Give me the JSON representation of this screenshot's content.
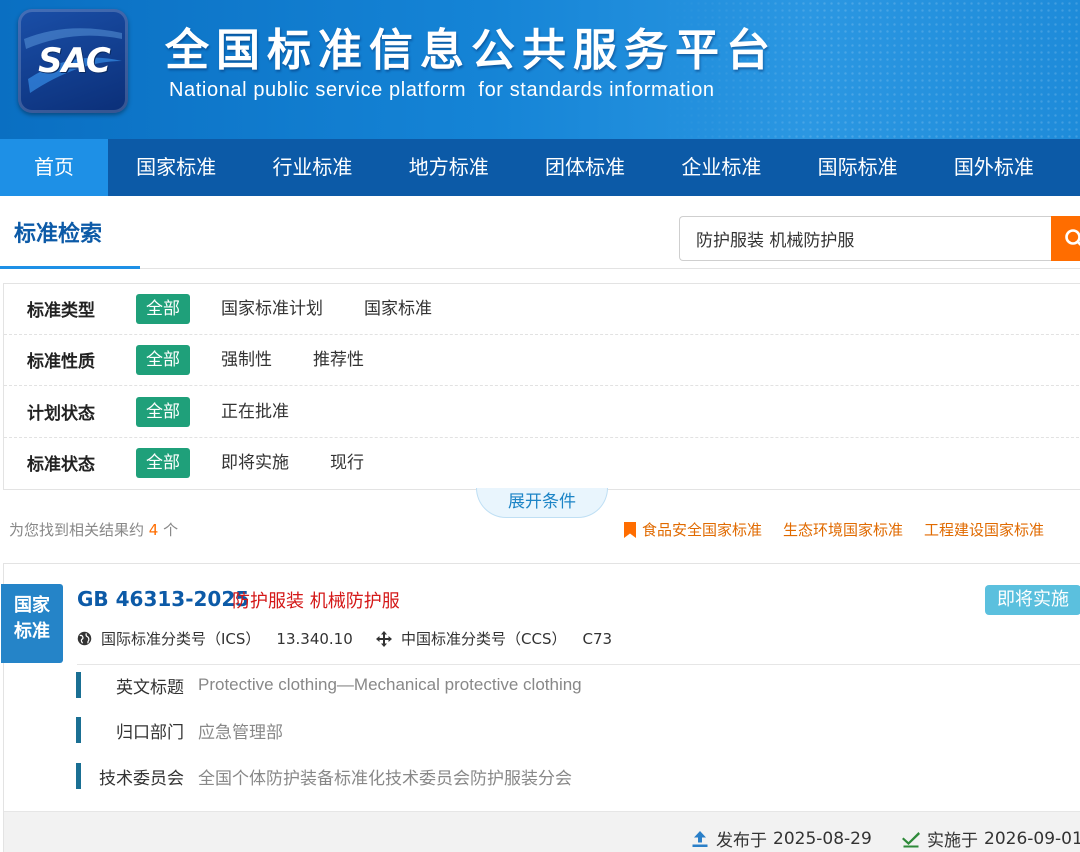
{
  "header": {
    "logo_text": "SAC",
    "title": "全国标准信息公共服务平台",
    "subtitle": "National public service platform  for standards information"
  },
  "nav": {
    "items": [
      {
        "label": "首页",
        "active": true
      },
      {
        "label": "国家标准"
      },
      {
        "label": "行业标准"
      },
      {
        "label": "地方标准"
      },
      {
        "label": "团体标准"
      },
      {
        "label": "企业标准"
      },
      {
        "label": "国际标准"
      },
      {
        "label": "国外标准"
      }
    ]
  },
  "search": {
    "section_title": "标准检索",
    "query": "防护服装 机械防护服"
  },
  "filters": [
    {
      "label": "标准类型",
      "options": [
        "全部",
        "国家标准计划",
        "国家标准"
      ]
    },
    {
      "label": "标准性质",
      "options": [
        "全部",
        "强制性",
        "推荐性"
      ]
    },
    {
      "label": "计划状态",
      "options": [
        "全部",
        "正在批准"
      ]
    },
    {
      "label": "标准状态",
      "options": [
        "全部",
        "即将实施",
        "现行"
      ]
    }
  ],
  "expand_label": "展开条件",
  "results": {
    "count_prefix": "为您找到相关结果约",
    "count": "4",
    "count_suffix": "个",
    "quick_links": [
      "食品安全国家标准",
      "生态环境国家标准",
      "工程建设国家标准"
    ]
  },
  "card": {
    "tag_line1": "国家",
    "tag_line2": "标准",
    "code": "GB 46313-2025",
    "name": "防护服装 机械防护服",
    "status": "即将实施",
    "ics_label": "国际标准分类号（ICS）",
    "ics_value": "13.340.10",
    "ccs_label": "中国标准分类号（CCS）",
    "ccs_value": "C73",
    "details": [
      {
        "label": "英文标题",
        "value": "Protective clothing—Mechanical protective clothing"
      },
      {
        "label": "归口部门",
        "value": "应急管理部"
      },
      {
        "label": "技术委员会",
        "value": "全国个体防护装备标准化技术委员会防护服装分会"
      }
    ],
    "publish_label": "发布于",
    "publish_date": "2025-08-29",
    "implement_label": "实施于",
    "implement_date": "2026-09-01"
  },
  "colors": {
    "header_blue": "#1584d6",
    "nav_blue": "#0c5aa7",
    "nav_active": "#1e90e6",
    "chip_selected": "#1fa07a",
    "accent_orange": "#ff6d00",
    "title_red": "#d41818",
    "status_badge": "#5bc0de"
  },
  "icons": [
    "search-icon",
    "bookmark-icon",
    "globe-icon",
    "move-cross-icon",
    "upload-icon",
    "check-icon"
  ]
}
